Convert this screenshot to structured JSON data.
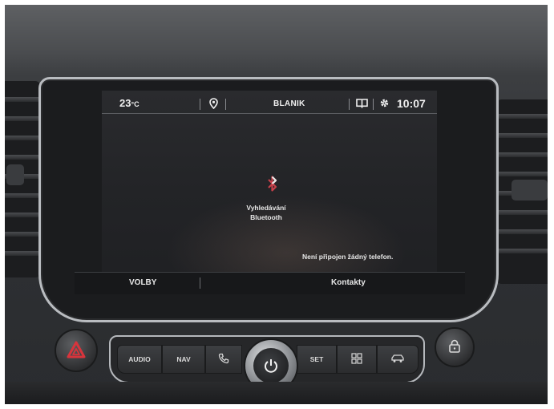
{
  "status_bar": {
    "temperature": "23",
    "temperature_unit": "°C",
    "station": "BLANIK",
    "time": "10:07"
  },
  "bluetooth": {
    "label_line1": "Vyhledávání",
    "label_line2": "Bluetooth",
    "phone_status": "Není připojen žádný telefon."
  },
  "bottom_bar": {
    "left_label": "VOLBY",
    "center_label": "Kontakty"
  },
  "hard_buttons": {
    "audio": "AUDIO",
    "nav": "NAV",
    "set": "SET"
  },
  "icons": [
    "navigation-pin-icon",
    "book-icon",
    "gear-icon",
    "bluetooth-icon",
    "hazard-icon",
    "phone-icon",
    "power-icon",
    "apps-grid-icon",
    "car-icon",
    "lock-icon"
  ],
  "colors": {
    "bluetooth_accent": "#c8404a",
    "screen_text": "#f0f0f0"
  }
}
